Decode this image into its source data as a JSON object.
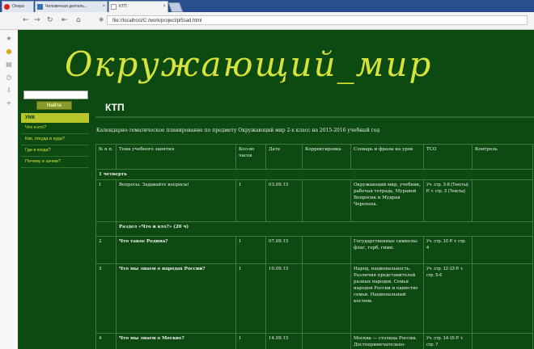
{
  "browser": {
    "tabs": [
      {
        "label": "Опера"
      },
      {
        "label": "Человечная деятель..."
      },
      {
        "label": "КТП"
      }
    ],
    "url": "file://localhost/C:/work/project/pl5sad.html"
  },
  "site": {
    "logo": "Окружающий_мир",
    "search": {
      "button_label": "Найти",
      "value": ""
    },
    "nav": {
      "header": "УМК",
      "items": [
        {
          "label": "Что и кто?"
        },
        {
          "label": "Как, откуда и куда?"
        },
        {
          "label": "Где и когда?"
        },
        {
          "label": "Почему и зачем?"
        }
      ]
    },
    "page_title": "КТП",
    "subtitle": "Календарно-тематическое планирование по предмету Окружающий мир 2-х класс на 2015-2016 учебный год"
  },
  "table": {
    "headers": [
      "№ п п.",
      "Тема учебного занятия",
      "Кол-во часов",
      "Дата",
      "Корректировка",
      "Словарь и фразы на урок",
      "ТСО",
      "Контроль"
    ],
    "quarter": "1 четверть",
    "rows": [
      {
        "n": "1",
        "topic": "Вопросы. Задавайте вопросы!",
        "hours": "1",
        "date": "03.09.15",
        "corr": "",
        "vocab": "Окружающий мир, учебник, рабочая тетрадь, Муравей Вопросик и Мудрая Черепаха.",
        "tso": "Уч. стр. 3-8 (Тексты) Р. т. стр. 3 (Тексты)",
        "control": ""
      },
      {
        "section": "Раздел «Что и кто?» (20 ч)"
      },
      {
        "n": "2",
        "topic": "Что такое Родина?",
        "hours": "1",
        "date": "07.09.15",
        "corr": "",
        "vocab": "Государственные символы: флаг, герб, гимн.",
        "tso": "Уч. стр. 10 Р. т. стр. 4",
        "control": ""
      },
      {
        "n": "3",
        "topic": "Что мы знаем о народах России?",
        "hours": "1",
        "date": "10.09.15",
        "corr": "",
        "vocab": "Народ, национальность. Различия представителей разных народов. Семья народов России и единство семьи. Национальный костюм.",
        "tso": "Уч. стр. 12-13 Р. т. стр. 5-6",
        "control": ""
      },
      {
        "n": "4",
        "topic": "Что мы знаем о Москве?",
        "hours": "1",
        "date": "14.09.15",
        "corr": "",
        "vocab": "Москва — столица России. Достопримечательно-",
        "tso": "Уч. стр. 14-15 Р. т. стр. 7",
        "control": ""
      }
    ]
  },
  "colors": {
    "page_bg": "#0d4a12",
    "logo": "#d6e33a",
    "nav_head": "#b9c62a",
    "button": "#8a9a2a"
  }
}
